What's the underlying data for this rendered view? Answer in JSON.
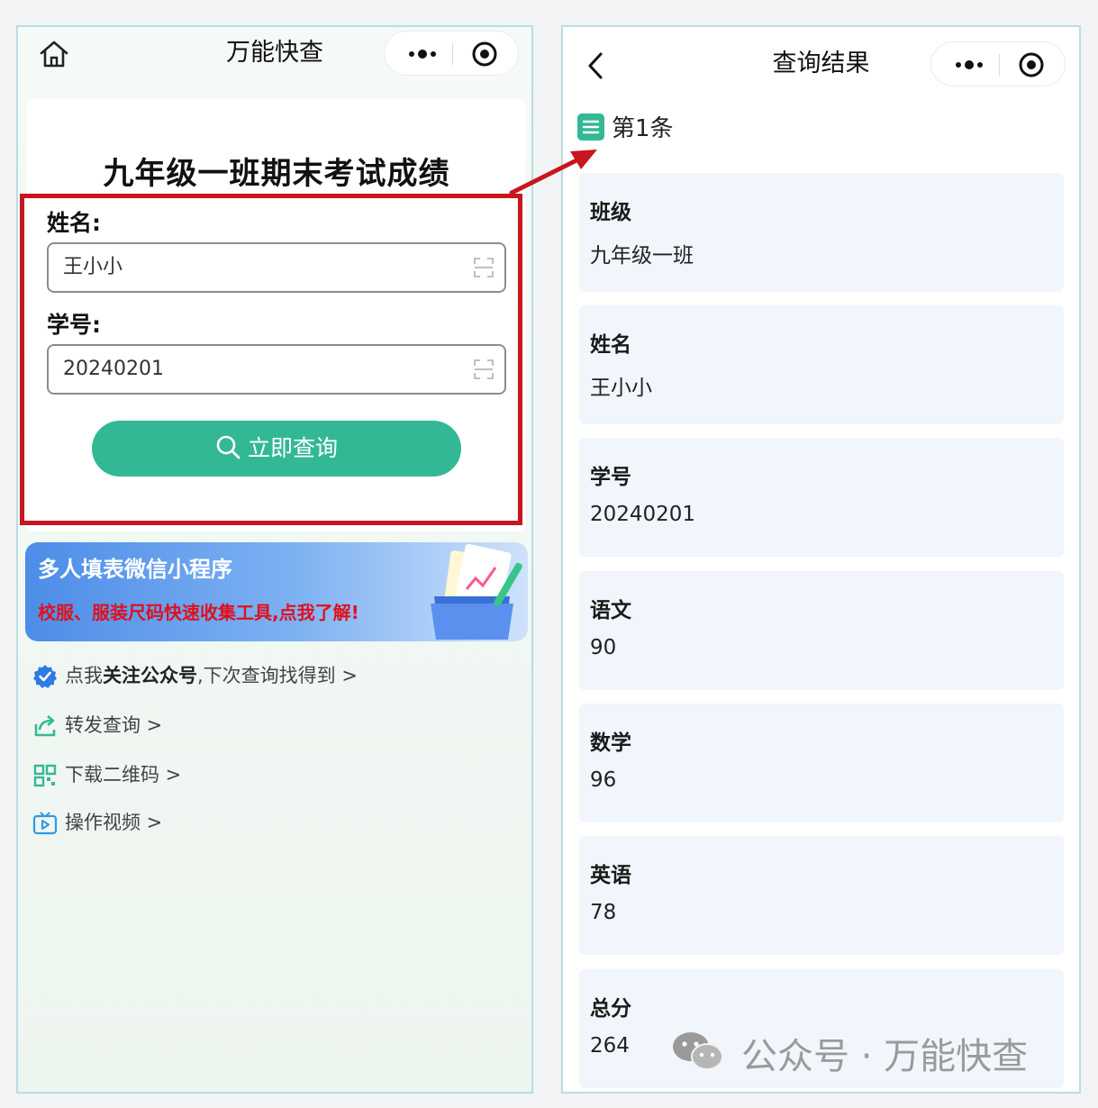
{
  "left_app": {
    "title": "万能快查",
    "form_title": "九年级一班期末考试成绩",
    "fields": [
      {
        "label": "姓名:",
        "value": "王小小"
      },
      {
        "label": "学号:",
        "value": "20240201"
      }
    ],
    "query_button": "立即查询",
    "banner": {
      "title": "多人填表微信小程序",
      "subtitle": "校服、服装尺码快速收集工具,点我了解!"
    },
    "links": [
      {
        "pre": "点我",
        "strong": "关注公众号",
        "post": ",下次查询找得到 >",
        "icon": "verified-badge-icon"
      },
      {
        "text": "转发查询 >",
        "icon": "share-icon"
      },
      {
        "text": "下载二维码 >",
        "icon": "qr-code-icon"
      },
      {
        "text": "操作视频 >",
        "icon": "video-play-icon"
      }
    ]
  },
  "right_app": {
    "title": "查询结果",
    "result_header": "第1条",
    "fields": [
      {
        "label": "班级",
        "value": "九年级一班"
      },
      {
        "label": "姓名",
        "value": "王小小"
      },
      {
        "label": "学号",
        "value": "20240201"
      },
      {
        "label": "语文",
        "value": "90"
      },
      {
        "label": "数学",
        "value": "96"
      },
      {
        "label": "英语",
        "value": "78"
      },
      {
        "label": "总分",
        "value": "264"
      }
    ]
  },
  "watermark": "公众号 · 万能快查",
  "colors": {
    "accent": "#33b896",
    "highlight": "#c8161e",
    "card": "#f0f6fb"
  }
}
